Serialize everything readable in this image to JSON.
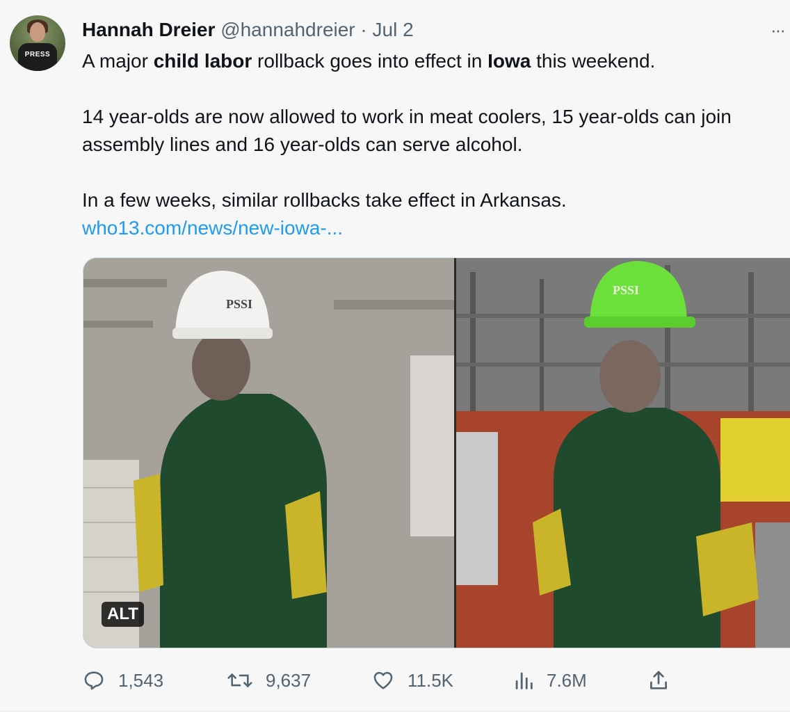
{
  "author": {
    "name": "Hannah Dreier",
    "handle": "@hannahdreier",
    "separator": "·",
    "date": "Jul 2",
    "avatar_badge": "PRESS"
  },
  "more_label": "···",
  "tweet": {
    "line1": {
      "pre": "A major ",
      "bold1": "child labor",
      "mid": " rollback goes into effect in ",
      "bold2": "Iowa",
      "post": " this weekend."
    },
    "line2": "14 year-olds are now allowed to work in meat coolers, 15 year-olds can join",
    "line3": "assembly lines and 16 year-olds can serve alcohol.",
    "line4": "In a few weeks, similar rollbacks take effect in Arkansas.",
    "link": "who13.com/news/new-iowa-..."
  },
  "media": {
    "alt_badge": "ALT",
    "left_helmet_text": "PSSI",
    "right_helmet_text": "PSSI"
  },
  "actions": {
    "replies": "1,543",
    "retweets": "9,637",
    "likes": "11.5K",
    "views": "7.6M"
  },
  "colors": {
    "link": "#1d9bf0",
    "text": "#0f1419",
    "secondary": "#536471"
  }
}
